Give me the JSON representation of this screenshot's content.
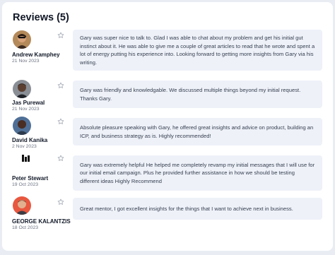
{
  "header": {
    "title": "Reviews (5)"
  },
  "reviews": [
    {
      "name": "Andrew Kamphey",
      "date": "21 Nov 2023",
      "text": "Gary was super nice to talk to. Glad I was able to chat about my problem and get his initial gut instinct about it. He was able to give me a couple of great articles to read that he wrote and spent a lot of energy putting his experience into. Looking forward to getting more insights from Gary via his writing."
    },
    {
      "name": "Jas Purewal",
      "date": "21 Nov 2023",
      "text": "Gary was friendly and knowledgable. We discussed multiple things beyond my initial request. Thanks Gary."
    },
    {
      "name": "David Kanika",
      "date": "2 Nov 2023",
      "text": "Absolute pleasure speaking with Gary, he offered great insights and advice on product, building an ICP, and business strategy as is. Highly recommended!"
    },
    {
      "name": "Peter Stewart",
      "date": "19 Oct 2023",
      "text": "Gary was extremely helpful He helped me completely revamp my initial messages that I will use for our initial email campaign. Plus he provided further assistance in how we should be testing different ideas Highly Recommend"
    },
    {
      "name": "GEORGE KALANTZIS",
      "date": "18 Oct 2023",
      "text": "Great mentor, I got excellent insights for the things that I want to achieve next in business."
    }
  ],
  "colors": {
    "background": "#e9edf3",
    "card": "#ffffff",
    "bubble": "#eef1f8",
    "star_outline": "#9ca3af"
  },
  "icons": [
    "star-outline-icon",
    "avatar"
  ]
}
